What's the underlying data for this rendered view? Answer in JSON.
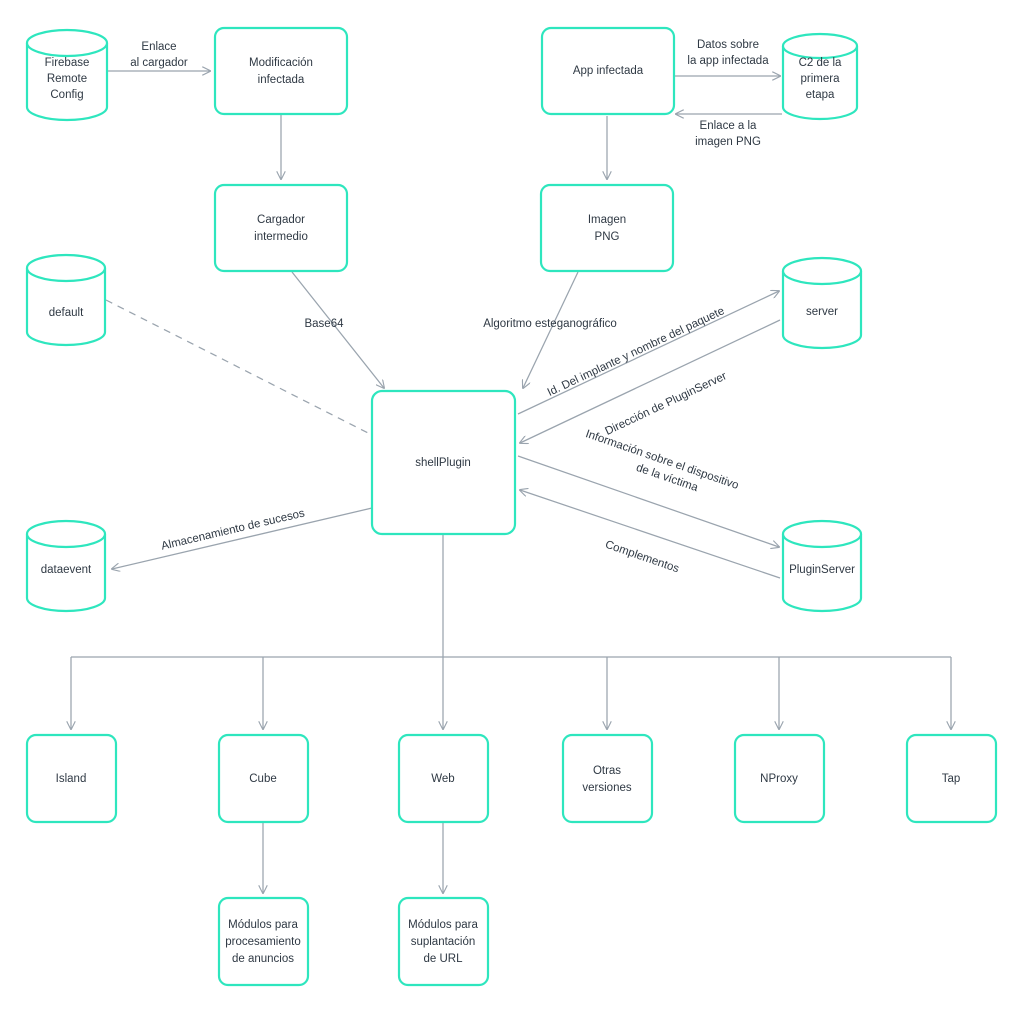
{
  "diagram": {
    "type": "flowchart",
    "colors": {
      "node_stroke": "#2EE6BE",
      "node_fill": "#FFFFFF",
      "edge": "#9AA4AE",
      "text": "#2F3944",
      "background": "#FFFFFF"
    },
    "nodes": [
      {
        "id": "firebase",
        "shape": "cylinder",
        "lines": [
          "Firebase",
          "Remote",
          "Config"
        ]
      },
      {
        "id": "modificacion",
        "shape": "box",
        "lines": [
          "Modificación",
          "infectada"
        ]
      },
      {
        "id": "app",
        "shape": "box",
        "lines": [
          "App infectada"
        ]
      },
      {
        "id": "c2",
        "shape": "cylinder",
        "lines": [
          "C2 de la",
          "primera",
          "etapa"
        ]
      },
      {
        "id": "cargador",
        "shape": "box",
        "lines": [
          "Cargador",
          "intermedio"
        ]
      },
      {
        "id": "imagen",
        "shape": "box",
        "lines": [
          "Imagen",
          "PNG"
        ]
      },
      {
        "id": "default",
        "shape": "cylinder",
        "lines": [
          "default"
        ]
      },
      {
        "id": "server",
        "shape": "cylinder",
        "lines": [
          "server"
        ]
      },
      {
        "id": "shellplugin",
        "shape": "box",
        "lines": [
          "shellPlugin"
        ]
      },
      {
        "id": "dataevent",
        "shape": "cylinder",
        "lines": [
          "dataevent"
        ]
      },
      {
        "id": "pluginserver",
        "shape": "cylinder",
        "lines": [
          "PluginServer"
        ]
      },
      {
        "id": "island",
        "shape": "box",
        "lines": [
          "Island"
        ]
      },
      {
        "id": "cube",
        "shape": "box",
        "lines": [
          "Cube"
        ]
      },
      {
        "id": "web",
        "shape": "box",
        "lines": [
          "Web"
        ]
      },
      {
        "id": "otras",
        "shape": "box",
        "lines": [
          "Otras",
          "versiones"
        ]
      },
      {
        "id": "nproxy",
        "shape": "box",
        "lines": [
          "NProxy"
        ]
      },
      {
        "id": "tap",
        "shape": "box",
        "lines": [
          "Tap"
        ]
      },
      {
        "id": "modanuncios",
        "shape": "box",
        "lines": [
          "Módulos para",
          "procesamiento",
          "de anuncios"
        ]
      },
      {
        "id": "modurl",
        "shape": "box",
        "lines": [
          "Módulos para",
          "suplantación",
          "de URL"
        ]
      }
    ],
    "edges": [
      {
        "from": "firebase",
        "to": "modificacion",
        "style": "solid",
        "lines": [
          "Enlace",
          "al cargador"
        ]
      },
      {
        "from": "modificacion",
        "to": "cargador",
        "style": "solid",
        "lines": []
      },
      {
        "from": "app",
        "to": "c2",
        "style": "solid",
        "lines": [
          "Datos sobre",
          "la app infectada"
        ]
      },
      {
        "from": "c2",
        "to": "app",
        "style": "solid",
        "lines": [
          "Enlace a la",
          "imagen PNG"
        ]
      },
      {
        "from": "app",
        "to": "imagen",
        "style": "solid",
        "lines": []
      },
      {
        "from": "cargador",
        "to": "shellplugin",
        "style": "solid",
        "lines": [
          "Base64"
        ]
      },
      {
        "from": "imagen",
        "to": "shellplugin",
        "style": "solid",
        "lines": [
          "Algoritmo esteganográfico"
        ]
      },
      {
        "from": "default",
        "to": "shellplugin",
        "style": "dashed",
        "lines": []
      },
      {
        "from": "shellplugin",
        "to": "server",
        "style": "solid",
        "lines": [
          "Id. Del implante y nombre del paquete"
        ]
      },
      {
        "from": "server",
        "to": "shellplugin",
        "style": "solid",
        "lines": [
          "Dirección de PluginServer"
        ]
      },
      {
        "from": "shellplugin",
        "to": "pluginserver",
        "style": "solid",
        "lines": [
          "Información sobre el dispositivo",
          "de la víctima"
        ]
      },
      {
        "from": "pluginserver",
        "to": "shellplugin",
        "style": "solid",
        "lines": [
          "Complementos"
        ]
      },
      {
        "from": "shellplugin",
        "to": "dataevent",
        "style": "solid",
        "lines": [
          "Almacenamiento de sucesos"
        ]
      },
      {
        "from": "shellplugin",
        "to": "island",
        "style": "solid",
        "lines": []
      },
      {
        "from": "shellplugin",
        "to": "cube",
        "style": "solid",
        "lines": []
      },
      {
        "from": "shellplugin",
        "to": "web",
        "style": "solid",
        "lines": []
      },
      {
        "from": "shellplugin",
        "to": "otras",
        "style": "solid",
        "lines": []
      },
      {
        "from": "shellplugin",
        "to": "nproxy",
        "style": "solid",
        "lines": []
      },
      {
        "from": "shellplugin",
        "to": "tap",
        "style": "solid",
        "lines": []
      },
      {
        "from": "cube",
        "to": "modanuncios",
        "style": "solid",
        "lines": []
      },
      {
        "from": "web",
        "to": "modurl",
        "style": "solid",
        "lines": []
      }
    ],
    "labels": {
      "firebase_l1": "Firebase",
      "firebase_l2": "Remote",
      "firebase_l3": "Config",
      "modificacion_l1": "Modificación",
      "modificacion_l2": "infectada",
      "app_l1": "App infectada",
      "c2_l1": "C2 de la",
      "c2_l2": "primera",
      "c2_l3": "etapa",
      "cargador_l1": "Cargador",
      "cargador_l2": "intermedio",
      "imagen_l1": "Imagen",
      "imagen_l2": "PNG",
      "default_l1": "default",
      "server_l1": "server",
      "shellplugin_l1": "shellPlugin",
      "dataevent_l1": "dataevent",
      "pluginserver_l1": "PluginServer",
      "island_l1": "Island",
      "cube_l1": "Cube",
      "web_l1": "Web",
      "otras_l1": "Otras",
      "otras_l2": "versiones",
      "nproxy_l1": "NProxy",
      "tap_l1": "Tap",
      "modanuncios_l1": "Módulos para",
      "modanuncios_l2": "procesamiento",
      "modanuncios_l3": "de anuncios",
      "modurl_l1": "Módulos para",
      "modurl_l2": "suplantación",
      "modurl_l3": "de URL",
      "e_enlace_l1": "Enlace",
      "e_enlace_l2": "al cargador",
      "e_datos_l1": "Datos sobre",
      "e_datos_l2": "la app infectada",
      "e_enlacepng_l1": "Enlace a la",
      "e_enlacepng_l2": "imagen PNG",
      "e_base64": "Base64",
      "e_algoritmo": "Algoritmo esteganográfico",
      "e_idimplante": "Id. Del implante y nombre del paquete",
      "e_direccion": "Dirección de PluginServer",
      "e_info_l1": "Información sobre el dispositivo",
      "e_info_l2": "de la víctima",
      "e_complementos": "Complementos",
      "e_almacenamiento": "Almacenamiento de sucesos"
    }
  }
}
